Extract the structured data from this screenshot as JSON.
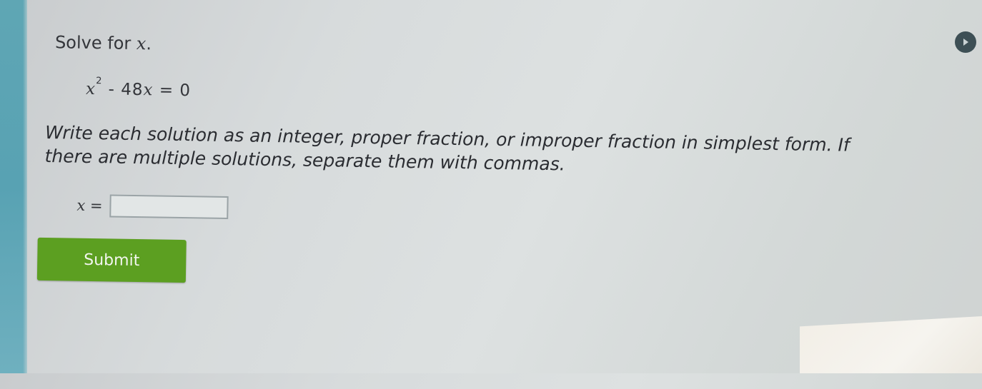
{
  "problem": {
    "prompt_text": "Solve for ",
    "prompt_var": "x",
    "prompt_end": ".",
    "equation": {
      "var": "x",
      "exponent": "2",
      "rest": " - 48",
      "var2": "x",
      "tail": " = 0"
    },
    "instructions": "Write each solution as an integer, proper fraction, or improper fraction in simplest form. If there are multiple solutions, separate them with commas.",
    "answer_var": "x",
    "answer_eq": " =",
    "answer_value": ""
  },
  "actions": {
    "submit_label": "Submit"
  },
  "colors": {
    "submit_green": "#5c9f21",
    "left_strip": "#5fa6b4"
  },
  "icons": {
    "top_right": "play-circle-icon"
  }
}
